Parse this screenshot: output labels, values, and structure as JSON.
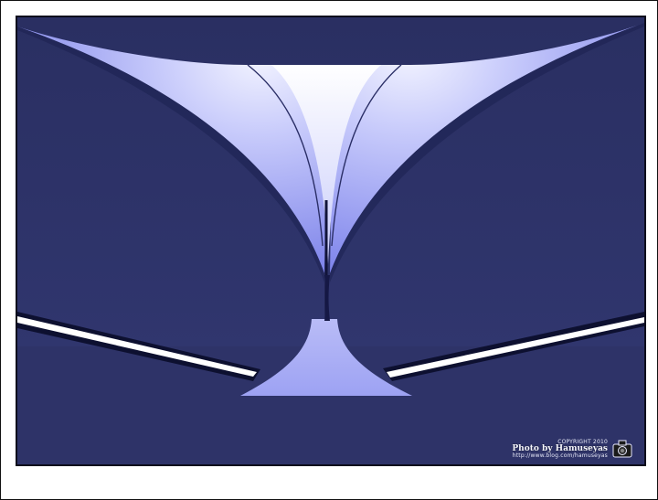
{
  "image": {
    "description_colors": {
      "wall": "#2d3266",
      "sail_light": "#f4f5ff",
      "sail_glow": "#8b8ff2",
      "light_tube": "#ffffff",
      "frame": "#ffffff"
    }
  },
  "watermark": {
    "line_top": "COPYRIGHT 2010",
    "line_main": "Photo by Hamuseyas",
    "line_bottom": "http://www.blog.com/hamuseyas",
    "icon": "camera-icon"
  }
}
